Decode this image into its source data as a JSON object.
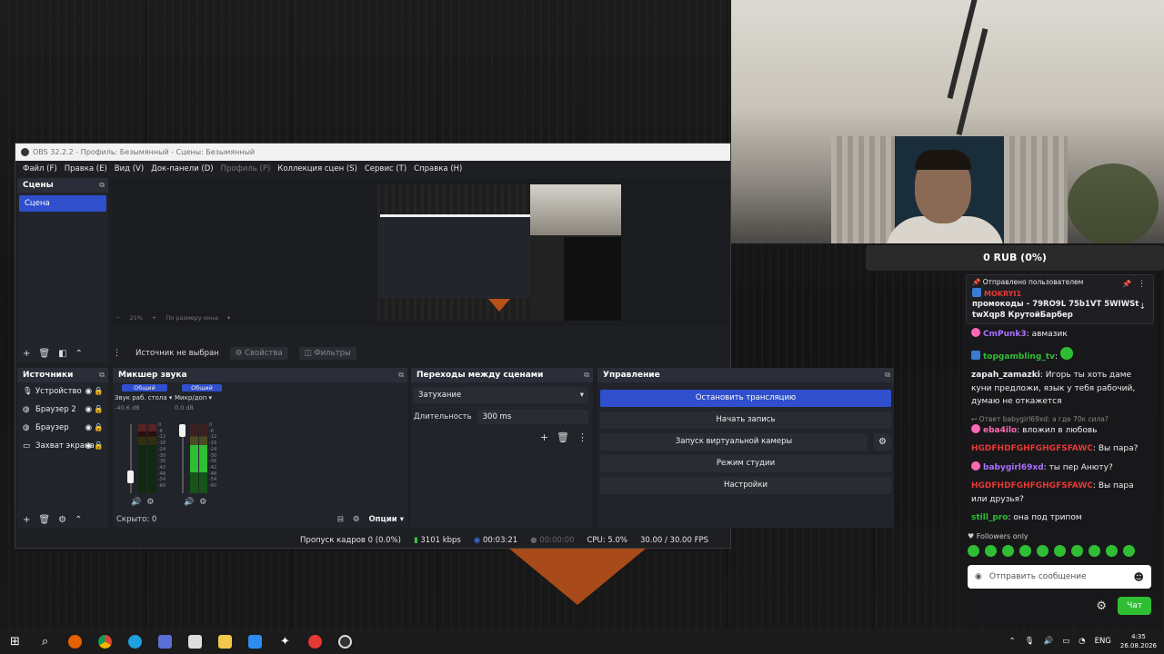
{
  "obs": {
    "title": "OBS 32.2.2 - Профиль: Безымянный - Сцены: Безымянный",
    "menu": [
      "Файл (F)",
      "Правка (E)",
      "Вид (V)",
      "Док-панели (D)",
      "Профиль (P)",
      "Коллекция сцен (S)",
      "Сервис (T)",
      "Справка (H)"
    ],
    "scenes": {
      "header": "Сцены",
      "items": [
        "Сцена"
      ]
    },
    "preview": {
      "zoom": "21%",
      "fit": "По размеру окна"
    },
    "source_bar": {
      "none": "Источник не выбран",
      "properties": "Свойства",
      "filters": "Фильтры"
    },
    "sources": {
      "header": "Источники",
      "items": [
        {
          "label": "Устройство",
          "icon": "mic-icon"
        },
        {
          "label": "Браузер 2",
          "icon": "browser-icon"
        },
        {
          "label": "Браузер",
          "icon": "browser-icon"
        },
        {
          "label": "Захват экрана",
          "icon": "monitor-icon"
        }
      ]
    },
    "mixer": {
      "header": "Микшер звука",
      "channels": [
        {
          "tag": "Общий",
          "name": "Звук раб. стола",
          "db": "-40.6 dB",
          "level": 0.1,
          "volume": 0.18
        },
        {
          "tag": "Общий",
          "name": "Микр/доп",
          "db": "0.0 dB",
          "level": 0.7,
          "volume": 1.0
        }
      ],
      "scale": [
        "0",
        "-6",
        "-12",
        "-18",
        "-24",
        "-30",
        "-36",
        "-42",
        "-48",
        "-54",
        "-60"
      ],
      "hidden": "Скрыто: 0",
      "options": "Опции"
    },
    "transitions": {
      "header": "Переходы между сценами",
      "selected": "Затухание",
      "duration_label": "Длительность",
      "duration": "300 ms"
    },
    "controls": {
      "header": "Управление",
      "stop_stream": "Остановить трансляцию",
      "start_record": "Начать запись",
      "virtual_cam": "Запуск виртуальной камеры",
      "studio": "Режим студии",
      "settings": "Настройки"
    },
    "status": {
      "dropped": "Пропуск кадров 0 (0.0%)",
      "bitrate": "3101 kbps",
      "stream_time": "00:03:21",
      "rec_time": "00:00:00",
      "cpu": "CPU: 5.0%",
      "fps": "30.00 / 30.00 FPS"
    }
  },
  "donation": {
    "text": "0 RUB (0%)"
  },
  "chat": {
    "pinned": {
      "sent_by": "Отправлено пользователем",
      "user": "MOKRYI1",
      "message": "промокоды - 79RO9L 75b1VT 5WIWSt twXqp8 КрутойБарбер"
    },
    "messages": [
      {
        "user": "CmPunk3",
        "color": "#a970ff",
        "text": "авмазик",
        "reply": ""
      },
      {
        "user": "topgambling_tv",
        "color": "#2fbe33",
        "text": "",
        "reply": ""
      },
      {
        "user": "zapah_zamazki",
        "color": "#efeff1",
        "text": "Игорь ты хоть даме куни предложи, язык у тебя рабочий, думаю не откажется",
        "reply": ""
      },
      {
        "user": "eba4ilo",
        "color": "#ff69b4",
        "text": "вложил в любовь",
        "reply": "Ответ babygirl69xd: а где 70к сила?"
      },
      {
        "user": "HGDFHDFGHFGHGFSFAWC",
        "color": "#e53935",
        "text": "Вы пара?",
        "reply": ""
      },
      {
        "user": "babygirl69xd",
        "color": "#a970ff",
        "text": "ты пер Анюту?",
        "reply": ""
      },
      {
        "user": "HGDFHDFGHFGHGFSFAWC",
        "color": "#e53935",
        "text": "Вы пара или друзья?",
        "reply": ""
      },
      {
        "user": "still_pro",
        "color": "#2fbe33",
        "text": "она под трипом",
        "reply": ""
      }
    ],
    "followers_only": "Followers only",
    "input_placeholder": "Отправить сообщение",
    "send_button": "Чат"
  },
  "taskbar": {
    "lang": "ENG",
    "time": "4:35",
    "date": "26.08.2026"
  }
}
